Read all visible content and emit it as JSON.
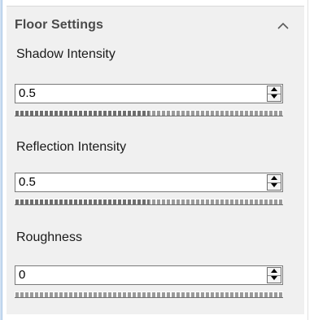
{
  "section": {
    "title": "Floor Settings",
    "collapse_icon": "chevron-up-icon",
    "collapsed": false
  },
  "fields": [
    {
      "label": "Shadow Intensity",
      "value": "0.5",
      "slider_level": 0.5
    },
    {
      "label": "Reflection Intensity",
      "value": "0.5",
      "slider_level": 0.5
    },
    {
      "label": "Roughness",
      "value": "0",
      "slider_level": 0
    }
  ],
  "spinner_icons": {
    "up": "triangle-up-icon",
    "down": "triangle-down-icon"
  },
  "colors": {
    "panel_background": "#f0f0f0",
    "section_title": "#4a4a4a",
    "input_border": "#7a7a7a",
    "left_accent": "#a7c5e6"
  }
}
